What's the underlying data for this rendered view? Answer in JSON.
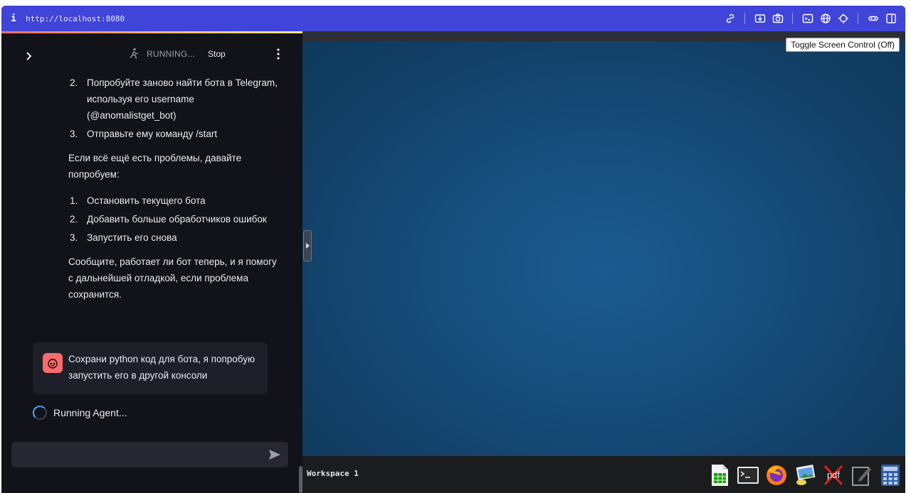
{
  "browser": {
    "info_icon": "i",
    "url": "http://localhost:8080",
    "tools": [
      "link-icon",
      "download-icon",
      "camera-icon",
      "terminal-icon",
      "globe-icon",
      "crosshair-icon",
      "swap-icon",
      "split-view-icon"
    ]
  },
  "sidebar": {
    "status_label": "RUNNING...",
    "stop_label": "Stop",
    "message": {
      "list_a": [
        {
          "num": "2.",
          "text": "Попробуйте заново найти бота в Telegram, используя его username (@anomalistget_bot)"
        },
        {
          "num": "3.",
          "text": "Отправьте ему команду /start"
        }
      ],
      "para1": "Если всё ещё есть проблемы, давайте попробуем:",
      "list_b": [
        {
          "num": "1.",
          "text": "Остановить текущего бота"
        },
        {
          "num": "2.",
          "text": "Добавить больше обработчиков ошибок"
        },
        {
          "num": "3.",
          "text": "Запустить его снова"
        }
      ],
      "para2": "Сообщите, работает ли бот теперь, и я помогу с дальнейшей отладкой, если проблема сохранится."
    },
    "user_message": "Сохрани python код для бота, я попробую запустить его в другой консоли",
    "running_text": "Running Agent...",
    "input_value": "",
    "input_placeholder": ""
  },
  "desktop": {
    "toggle_label": "Toggle Screen Control (Off)",
    "workspace_label": "Workspace 1",
    "taskbar_apps": [
      "spreadsheet-icon",
      "terminal-icon",
      "firefox-icon",
      "image-viewer-icon",
      "pdf-icon",
      "text-editor-icon",
      "calculator-icon"
    ],
    "pdf_text": "pdf"
  },
  "colors": {
    "url_bar": "#4044d8",
    "sidebar_bg": "#111318",
    "desktop_bg": "#17507f",
    "user_avatar": "#ff6b6b",
    "spinner": "#4fa3ff"
  }
}
